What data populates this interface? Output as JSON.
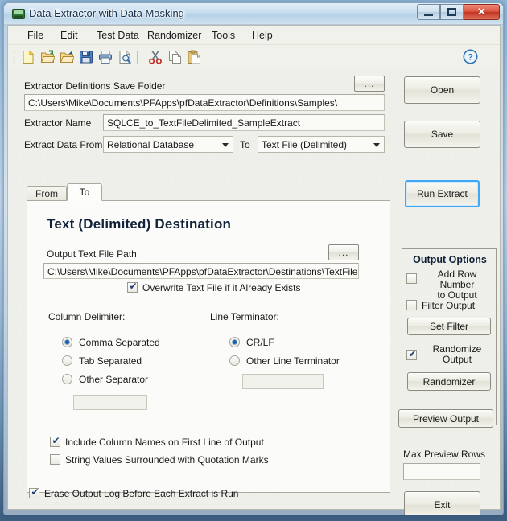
{
  "window": {
    "title": "Data Extractor with Data Masking",
    "icon": "app-database-icon",
    "buttons": {
      "minimize": "minimize",
      "maximize": "maximize",
      "close": "✕"
    }
  },
  "menubar": {
    "items": [
      {
        "label": "File"
      },
      {
        "label": "Edit"
      },
      {
        "label": "Test Data"
      },
      {
        "label": "Randomizer"
      },
      {
        "label": "Tools"
      },
      {
        "label": "Help"
      }
    ]
  },
  "toolbar": {
    "icons": [
      "new-document-icon",
      "open-folder-icon",
      "save-as-folder-icon",
      "save-disk-icon",
      "print-icon",
      "print-preview-icon",
      "cut-scissors-icon",
      "copy-icon",
      "paste-icon"
    ],
    "help_icon": "help-question-icon"
  },
  "form": {
    "save_folder_label": "Extractor Definitions Save Folder",
    "save_folder_value": "C:\\Users\\Mike\\Documents\\PFApps\\pfDataExtractor\\Definitions\\Samples\\",
    "browse_label": "...",
    "extractor_name_label": "Extractor Name",
    "extractor_name_value": "SQLCE_to_TextFileDelimited_SampleExtract",
    "extract_from_label": "Extract Data From",
    "extract_from_value": "Relational Database",
    "to_label": "To",
    "to_value": "Text File (Delimited)"
  },
  "tabs": [
    {
      "label": "From",
      "selected": false
    },
    {
      "label": "To",
      "selected": true
    }
  ],
  "panel": {
    "title": "Text (Delimited) Destination",
    "output_path_label": "Output Text File Path",
    "output_path_browse": "...",
    "output_path_value": "C:\\Users\\Mike\\Documents\\PFApps\\pfDataExtractor\\Destinations\\TextFiles\\De",
    "overwrite": {
      "label": "Overwrite Text File if it Already Exists",
      "checked": true
    },
    "column_delimiter_label": "Column Delimiter:",
    "column_delimiter_options": [
      {
        "label": "Comma Separated",
        "selected": true
      },
      {
        "label": "Tab Separated",
        "selected": false
      },
      {
        "label": "Other Separator",
        "selected": false
      }
    ],
    "other_separator_value": "",
    "line_terminator_label": "Line Terminator:",
    "line_terminator_options": [
      {
        "label": "CR/LF",
        "selected": true
      },
      {
        "label": "Other Line Terminator",
        "selected": false
      }
    ],
    "other_terminator_value": "",
    "include_column_names": {
      "label": "Include Column Names on First Line of Output",
      "checked": true
    },
    "quote_strings": {
      "label": "String Values Surrounded with Quotation Marks",
      "checked": false
    }
  },
  "footer": {
    "erase_log": {
      "label": "Erase Output Log Before Each Extract is Run",
      "checked": true
    }
  },
  "sidebar": {
    "open_label": "Open",
    "save_label": "Save",
    "run_extract_label": "Run Extract",
    "group_title": "Output Options",
    "add_row_number": {
      "label": "Add Row Number\nto Output",
      "line1": "Add Row Number",
      "line2": "to Output",
      "checked": false
    },
    "filter_output": {
      "label": "Filter Output",
      "checked": false
    },
    "set_filter_label": "Set Filter",
    "randomize_output": {
      "line1": "Randomize",
      "line2": "Output",
      "checked": true
    },
    "randomizer_label": "Randomizer",
    "preview_output_label": "Preview Output",
    "max_preview_rows_label": "Max Preview Rows",
    "max_preview_rows_value": "",
    "exit_label": "Exit"
  },
  "colors": {
    "accent": "#3fa9f5",
    "title_text": "#17314d",
    "panel_bg": "#fbfbf9",
    "client_bg": "#f0f0eb",
    "close_button": "#d9523c"
  }
}
